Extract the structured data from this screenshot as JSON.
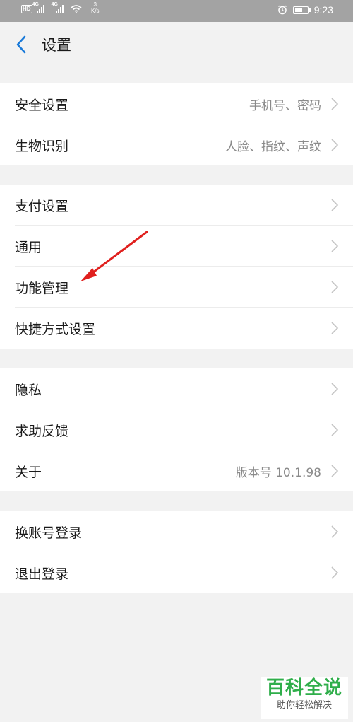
{
  "status_bar": {
    "hd": "HD",
    "net1": "4G",
    "net2": "4G",
    "speed_value": "3",
    "speed_unit": "K/s",
    "time": "9:23",
    "battery_level": 0.6,
    "icons": [
      "sim-hd-icon",
      "signal-icon",
      "wifi-icon",
      "alarm-icon",
      "battery-charging-icon"
    ]
  },
  "header": {
    "title": "设置",
    "back_icon": "chevron-left-icon"
  },
  "groups": [
    {
      "items": [
        {
          "label": "安全设置",
          "value": "手机号、密码"
        },
        {
          "label": "生物识别",
          "value": "人脸、指纹、声纹"
        }
      ]
    },
    {
      "items": [
        {
          "label": "支付设置",
          "value": ""
        },
        {
          "label": "通用",
          "value": ""
        },
        {
          "label": "功能管理",
          "value": ""
        },
        {
          "label": "快捷方式设置",
          "value": ""
        }
      ]
    },
    {
      "items": [
        {
          "label": "隐私",
          "value": ""
        },
        {
          "label": "求助反馈",
          "value": ""
        },
        {
          "label": "关于",
          "value": "版本号 10.1.98"
        }
      ]
    },
    {
      "items": [
        {
          "label": "换账号登录",
          "value": ""
        },
        {
          "label": "退出登录",
          "value": ""
        }
      ]
    }
  ],
  "watermark": {
    "title": "百科全说",
    "subtitle": "助你轻松解决"
  },
  "colors": {
    "accent": "#1a7ad9",
    "annotation_arrow": "#e0201e",
    "watermark_green": "#2fae4a"
  }
}
